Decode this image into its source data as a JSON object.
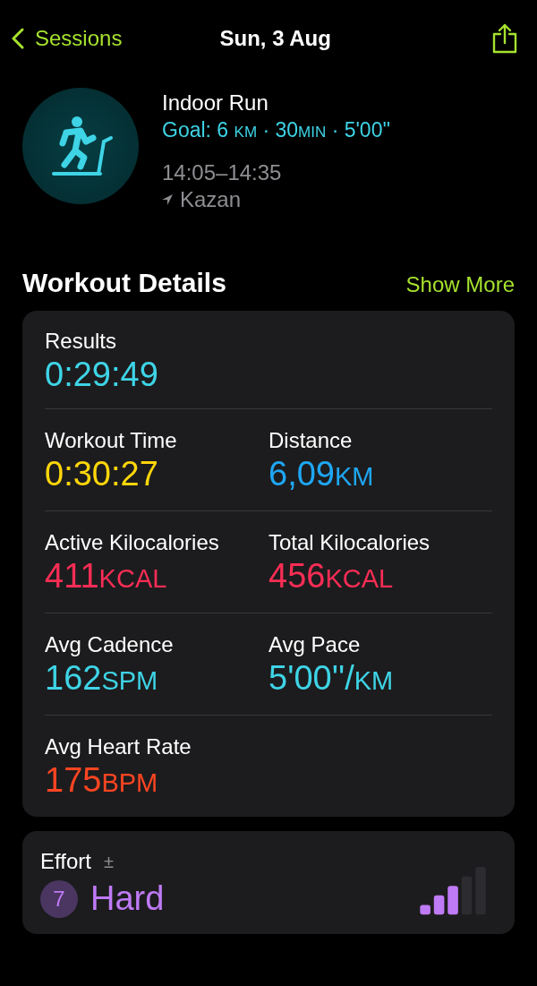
{
  "nav": {
    "back": "Sessions",
    "title": "Sun, 3 Aug"
  },
  "workout": {
    "name": "Indoor Run",
    "goal": [
      {
        "kind": "text",
        "text": "Goal: 6 "
      },
      {
        "kind": "unit",
        "text": "KM"
      },
      {
        "kind": "text",
        "text": " · 30"
      },
      {
        "kind": "unit",
        "text": "MIN"
      },
      {
        "kind": "text",
        "text": " · 5'00''"
      }
    ],
    "time": "14:05–14:35",
    "location": "Kazan"
  },
  "details": {
    "title": "Workout Details",
    "action": "Show More",
    "rows": [
      [
        {
          "label": "Results",
          "value": "0:29:49",
          "color": "#3ed4e6"
        }
      ],
      [
        {
          "label": "Workout Time",
          "value": "0:30:27",
          "color": "#ffd60a"
        },
        {
          "label": "Distance",
          "value": "6,09",
          "unit": "KM",
          "color": "#1fa7f5"
        }
      ],
      [
        {
          "label": "Active Kilocalories",
          "value": "411",
          "unit": "KCAL",
          "color": "#fa2d55"
        },
        {
          "label": "Total Kilocalories",
          "value": "456",
          "unit": "KCAL",
          "color": "#fa2d55"
        }
      ],
      [
        {
          "label": "Avg Cadence",
          "value": "162",
          "unit": "SPM",
          "color": "#3ed4e6"
        },
        {
          "label": "Avg Pace",
          "value": "5'00''/",
          "unit": "KM",
          "color": "#3ed4e6"
        }
      ],
      [
        {
          "label": "Avg Heart Rate",
          "value": "175",
          "unit": "BPM",
          "color": "#ff4522"
        }
      ]
    ]
  },
  "effort": {
    "label": "Effort",
    "adjust": "±",
    "score": "7",
    "rating": "Hard"
  }
}
